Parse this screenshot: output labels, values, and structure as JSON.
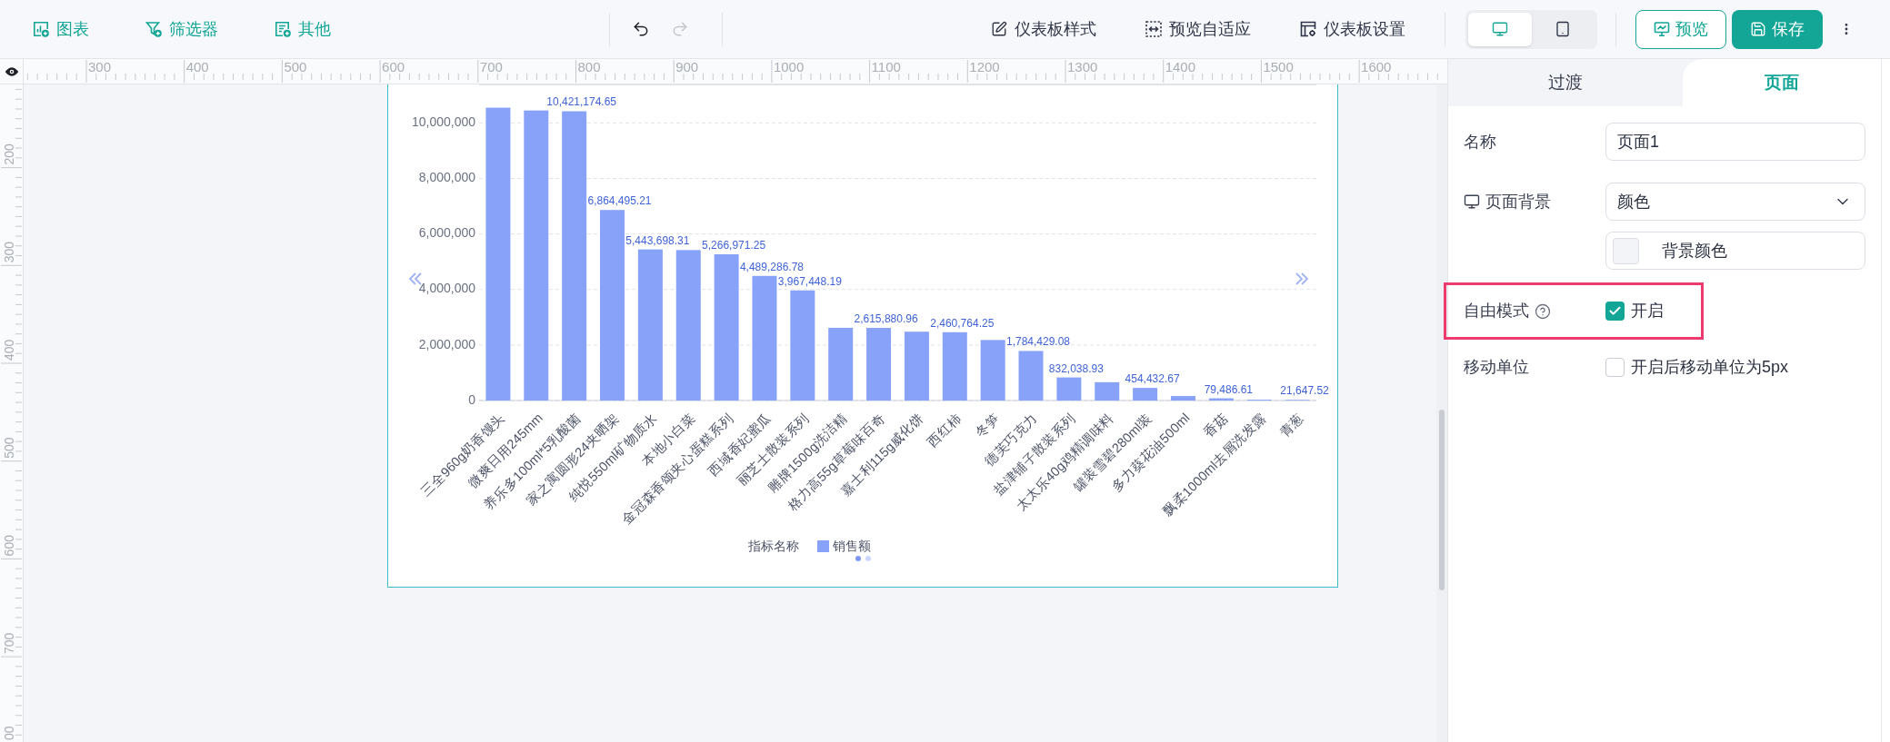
{
  "toolbar": {
    "insert_buttons": [
      {
        "label": "图表"
      },
      {
        "label": "筛选器"
      },
      {
        "label": "其他"
      }
    ],
    "history": [
      {
        "disabled": false
      },
      {
        "disabled": true
      }
    ],
    "dashboard_buttons": [
      {
        "label": "仪表板样式"
      },
      {
        "label": "预览自适应"
      },
      {
        "label": "仪表板设置"
      }
    ],
    "device_modes": [
      {
        "selected": true
      },
      {
        "selected": false
      }
    ],
    "preview_button": {
      "label": "预览"
    },
    "save_button": {
      "label": "保存"
    }
  },
  "rulers": {
    "horizontal": [
      "300",
      "400",
      "500",
      "600",
      "700",
      "800",
      "900",
      "1000",
      "1100",
      "1200",
      "1300",
      "1400",
      "1500",
      "1600"
    ],
    "vertical": [
      "200",
      "300",
      "400",
      "500",
      "600",
      "700",
      "00"
    ]
  },
  "chart_card": {
    "chart_data": {
      "type": "bar",
      "categories": [
        "三全960g奶香馒头",
        "微爽日用245mm",
        "养乐多100ml*5乳酸菌",
        "家之寓圆形24夹晒架",
        "纯悦550ml矿物质水",
        "本地小白菜",
        "金冠森香颂夹心蛋糕系列",
        "西域香妃蜜瓜",
        "丽芝士散装系列",
        "雕牌1500g洗洁精",
        "格力高55g草莓味百奇",
        "嘉士利115g威化饼",
        "西红柿",
        "冬笋",
        "德芙巧克力",
        "盐津铺子散装系列",
        "太太乐40g鸡精调味料",
        "罐装雪碧280ml装",
        "多力葵花油500ml",
        "香菇",
        "飘柔1000ml去屑洗发露",
        "青葱"
      ],
      "series": [
        {
          "name": "销售额",
          "color": "#87a2f8",
          "values": [
            10550000,
            10450000,
            10421174.65,
            6864495.21,
            5443698.31,
            5420000,
            5266971.25,
            4489286.78,
            3967448.19,
            2620000,
            2615880.96,
            2480000,
            2460764.25,
            2180000,
            1784429.08,
            832038.93,
            660000,
            454432.67,
            160000,
            79486.61,
            30000,
            21647.52
          ]
        }
      ],
      "ylim": [
        0,
        11370000
      ],
      "yticks": [
        {
          "value": 0,
          "label": "0"
        },
        {
          "value": 2000000,
          "label": "2,000,000"
        },
        {
          "value": 4000000,
          "label": "4,000,000"
        },
        {
          "value": 6000000,
          "label": "6,000,000"
        },
        {
          "value": 8000000,
          "label": "8,000,000"
        },
        {
          "value": 10000000,
          "label": "10,000,000"
        }
      ],
      "grid": true,
      "value_labels": [
        null,
        null,
        "10,421,174.65",
        "6,864,495.21",
        "5,443,698.31",
        null,
        "5,266,971.25",
        "4,489,286.78",
        "3,967,448.19",
        null,
        "2,615,880.96",
        null,
        "2,460,764.25",
        null,
        "1,784,429.08",
        "832,038.93",
        null,
        "454,432.67",
        null,
        "79,486.61",
        null,
        "21,647.52"
      ]
    },
    "legend_title": "指标名称",
    "pager": [
      {
        "selected": true
      },
      {
        "selected": false
      }
    ]
  },
  "panel": {
    "tabs": [
      {
        "label": "过渡",
        "selected": false
      },
      {
        "label": "页面",
        "selected": true
      }
    ],
    "fields": [
      {
        "kind": "input",
        "label": "名称",
        "value": "页面1"
      },
      {
        "kind": "select",
        "label": "页面背景",
        "value": "颜色"
      },
      {
        "kind": "color",
        "label": "背景颜色",
        "color": "#f3f4f8"
      },
      {
        "kind": "checkbox",
        "label": "自由模式",
        "help": true,
        "option": "开启",
        "checked": true,
        "highlighted": true
      },
      {
        "kind": "checkbox",
        "label": "移动单位",
        "option": "开启后移动单位为5px",
        "checked": false,
        "highlighted": false
      }
    ]
  }
}
